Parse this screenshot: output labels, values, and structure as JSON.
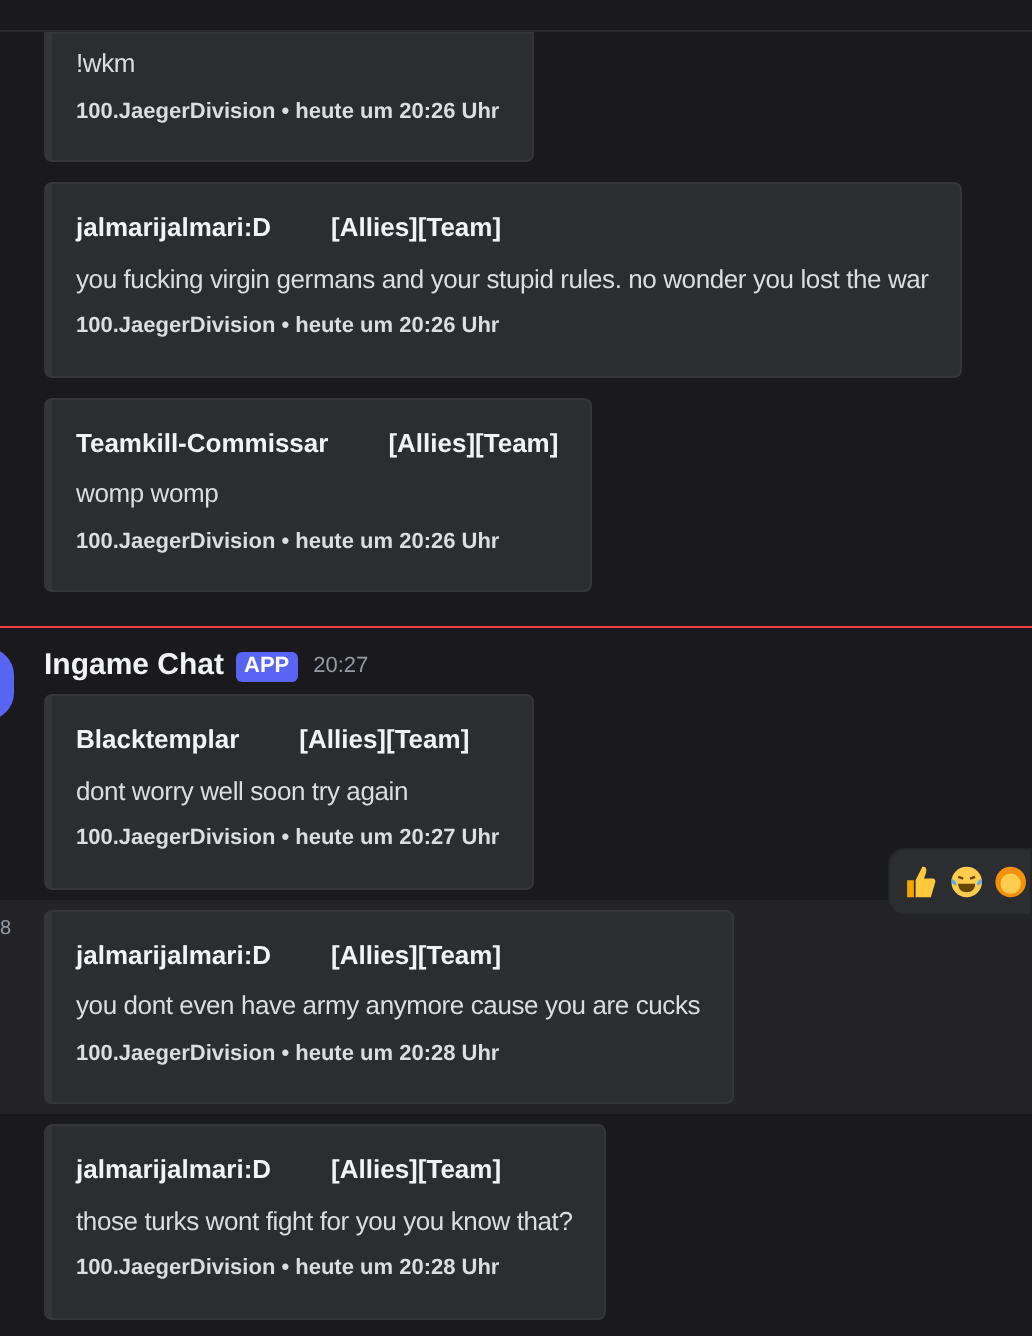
{
  "groups": [
    {
      "kind": "continuation",
      "unread_divider": false,
      "hovered": false,
      "embeds": [
        {
          "clipped": true,
          "text": "!wkm",
          "footer": "100.JaegerDivision • heute um 20:26 Uhr"
        },
        {
          "clipped": false,
          "author": "jalmarijalmari:D",
          "tag": "[Allies][Team]",
          "text": "you fucking virgin germans and your stupid rules. no wonder you lost the war",
          "footer": "100.JaegerDivision • heute um 20:26 Uhr"
        },
        {
          "clipped": false,
          "author": "Teamkill-Commissar",
          "tag": "[Allies][Team]",
          "text": "womp womp",
          "footer": "100.JaegerDivision • heute um 20:26 Uhr"
        }
      ]
    },
    {
      "kind": "message",
      "unread_divider": true,
      "hovered": false,
      "author": "Ingame Chat",
      "badge": "APP",
      "time": "20:27",
      "embeds": [
        {
          "clipped": false,
          "author": "Blacktemplar",
          "tag": "[Allies][Team]",
          "text": "dont worry well soon try again",
          "footer": "100.JaegerDivision • heute um 20:27 Uhr"
        }
      ]
    },
    {
      "kind": "continuation",
      "unread_divider": false,
      "hovered": true,
      "time_fragment": "8",
      "embeds": [
        {
          "clipped": false,
          "author": "jalmarijalmari:D",
          "tag": "[Allies][Team]",
          "text": "you dont even have army anymore cause you are cucks",
          "footer": "100.JaegerDivision • heute um 20:28 Uhr"
        }
      ]
    },
    {
      "kind": "continuation",
      "unread_divider": false,
      "hovered": false,
      "embeds": [
        {
          "clipped": false,
          "author": "jalmarijalmari:D",
          "tag": "[Allies][Team]",
          "text": "those turks wont fight for you you know that?",
          "footer": "100.JaegerDivision • heute um 20:28 Uhr"
        }
      ]
    }
  ]
}
